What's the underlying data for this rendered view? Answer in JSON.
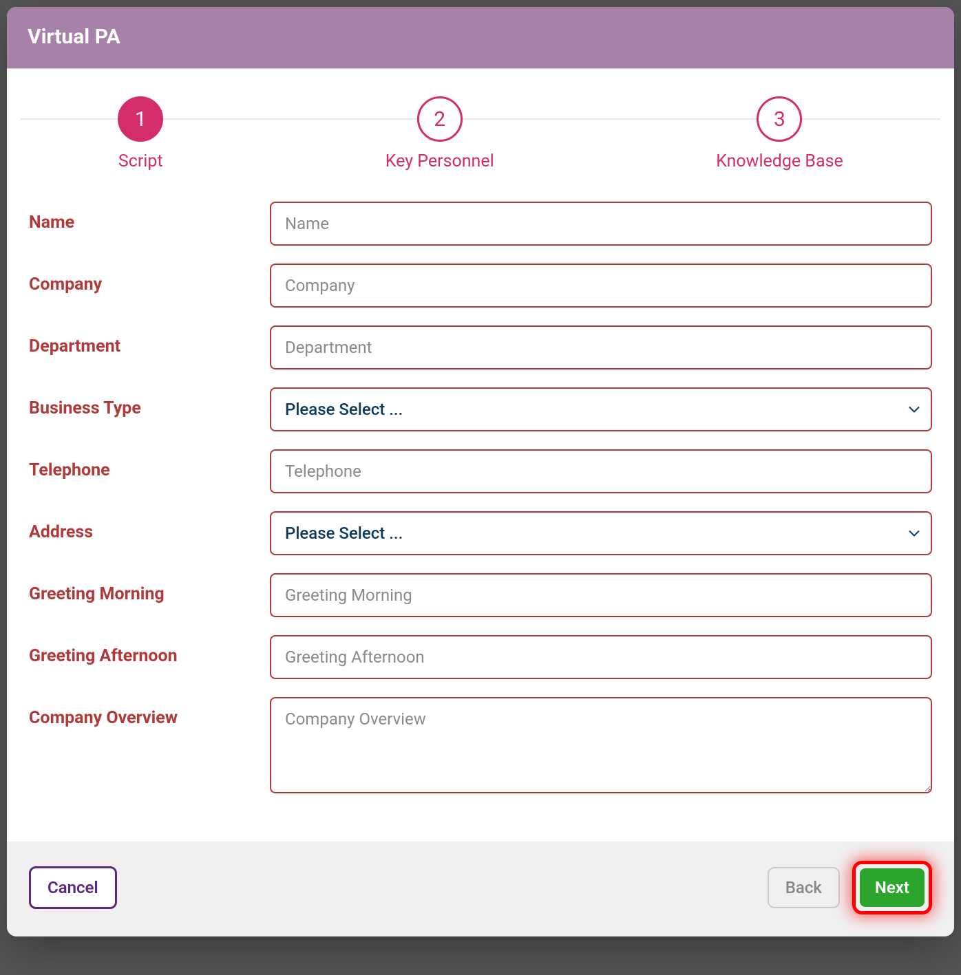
{
  "header": {
    "title": "Virtual PA"
  },
  "stepper": {
    "steps": [
      {
        "num": "1",
        "label": "Script",
        "active": true
      },
      {
        "num": "2",
        "label": "Key Personnel",
        "active": false
      },
      {
        "num": "3",
        "label": "Knowledge Base",
        "active": false
      }
    ]
  },
  "form": {
    "name": {
      "label": "Name",
      "placeholder": "Name",
      "value": ""
    },
    "company": {
      "label": "Company",
      "placeholder": "Company",
      "value": ""
    },
    "department": {
      "label": "Department",
      "placeholder": "Department",
      "value": ""
    },
    "business_type": {
      "label": "Business Type",
      "selected": "Please Select ..."
    },
    "telephone": {
      "label": "Telephone",
      "placeholder": "Telephone",
      "value": ""
    },
    "address": {
      "label": "Address",
      "selected": "Please Select ..."
    },
    "greeting_morning": {
      "label": "Greeting Morning",
      "placeholder": "Greeting Morning",
      "value": ""
    },
    "greeting_afternoon": {
      "label": "Greeting Afternoon",
      "placeholder": "Greeting Afternoon",
      "value": ""
    },
    "company_overview": {
      "label": "Company Overview",
      "placeholder": "Company Overview",
      "value": ""
    }
  },
  "footer": {
    "cancel": "Cancel",
    "back": "Back",
    "next": "Next"
  }
}
